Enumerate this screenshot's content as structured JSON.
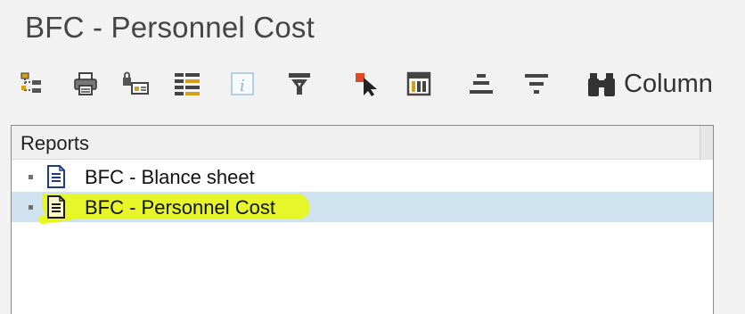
{
  "window": {
    "title": "BFC - Personnel Cost"
  },
  "toolbar": {
    "buttons": [
      {
        "name": "hierarchy-icon"
      },
      {
        "name": "print-icon"
      },
      {
        "name": "variant-icon"
      },
      {
        "name": "list-layout-icon"
      },
      {
        "name": "info-icon"
      },
      {
        "name": "filter-text-icon"
      },
      {
        "name": "select-cursor-icon"
      },
      {
        "name": "table-calculator-icon"
      },
      {
        "name": "align-icon"
      },
      {
        "name": "filter-icon"
      }
    ],
    "column_label": "Column"
  },
  "tree": {
    "header": "Reports",
    "items": [
      {
        "label": "BFC - Blance sheet",
        "selected": false,
        "icon": "document-icon"
      },
      {
        "label": "BFC - Personnel Cost",
        "selected": true,
        "icon": "document-icon"
      }
    ]
  },
  "colors": {
    "selection": "#cfe2ef",
    "highlight": "#e8f71e",
    "icon_blue": "#1e3a8a",
    "icon_orange": "#d46a1e"
  }
}
